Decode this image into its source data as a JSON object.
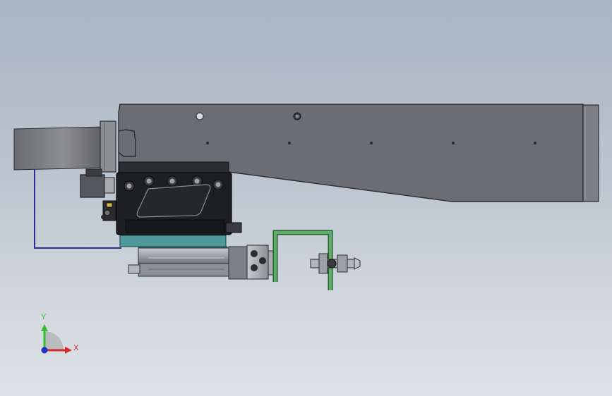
{
  "triad": {
    "y_label": "Y",
    "x_label": "X",
    "y_color": "#2fbf2f",
    "x_color": "#d42a2a",
    "z_color": "#1f2fd0"
  },
  "colors": {
    "sheet_metal": "#6b6d72",
    "sheet_edge": "#2b2c30",
    "tube": "#8a8b8f",
    "dark_body": "#1e1f23",
    "teal_plate": "#4f9a9c",
    "green_bracket": "#3f8f4a",
    "wire": "#2a2e8c",
    "cylinder": "#9fa3a8"
  }
}
